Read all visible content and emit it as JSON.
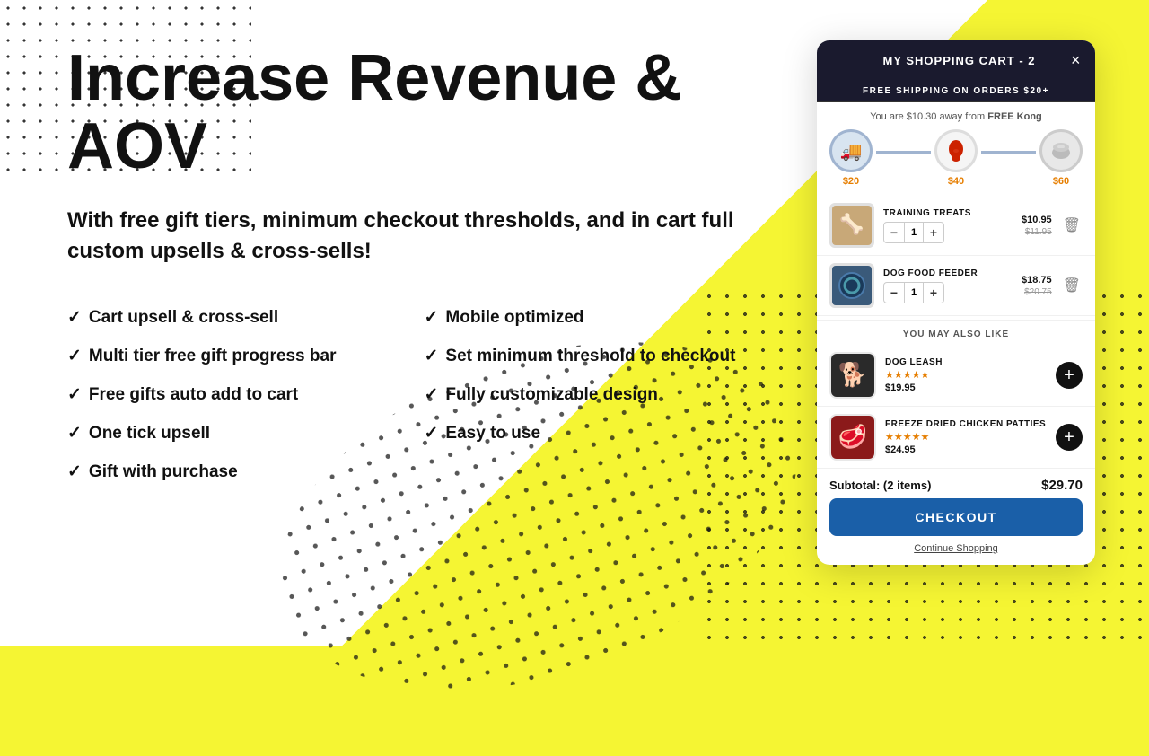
{
  "background": {
    "accent_color": "#f5f533",
    "white_color": "#ffffff"
  },
  "headline": "Increase Revenue & AOV",
  "subtitle": "With free gift tiers, minimum checkout thresholds, and in cart full custom upsells & cross-sells!",
  "features": {
    "col1": [
      "Cart upsell & cross-sell",
      "Multi tier free gift progress bar",
      "Free gifts auto add to cart",
      "One tick upsell",
      "Gift with purchase"
    ],
    "col2": [
      "Mobile optimized",
      "Set minimum threshold to checkout",
      "Fully customizable design",
      "Easy to use"
    ]
  },
  "cart": {
    "title": "MY SHOPPING CART - 2",
    "close_label": "×",
    "free_shipping_bar": "FREE SHIPPING ON ORDERS $20+",
    "progress_text": "You are $10.30 away from",
    "progress_highlight": "FREE Kong",
    "tiers": [
      {
        "label": "$20",
        "icon": "🚚",
        "state": "active"
      },
      {
        "label": "$40",
        "icon": "🔴",
        "state": "normal"
      },
      {
        "label": "$60",
        "icon": "🪣",
        "state": "grey"
      }
    ],
    "items": [
      {
        "name": "TRAINING TREATS",
        "qty": 1,
        "price_sale": "$10.95",
        "price_original": "$11.95",
        "emoji": "🐾"
      },
      {
        "name": "DOG FOOD FEEDER",
        "qty": 1,
        "price_sale": "$18.75",
        "price_original": "$20.75",
        "emoji": "🥣"
      }
    ],
    "you_may_like": "YOU MAY ALSO LIKE",
    "recommendations": [
      {
        "name": "DOG LEASH",
        "stars": "★★★★★",
        "price": "$19.95",
        "emoji": "🦮"
      },
      {
        "name": "FREEZE DRIED CHICKEN PATTIES",
        "stars": "★★★★★",
        "price": "$24.95",
        "emoji": "🍗"
      }
    ],
    "subtotal_label": "Subtotal: (2 items)",
    "subtotal_amount": "$29.70",
    "checkout_label": "CHECKOUT",
    "continue_label": "Continue Shopping"
  }
}
